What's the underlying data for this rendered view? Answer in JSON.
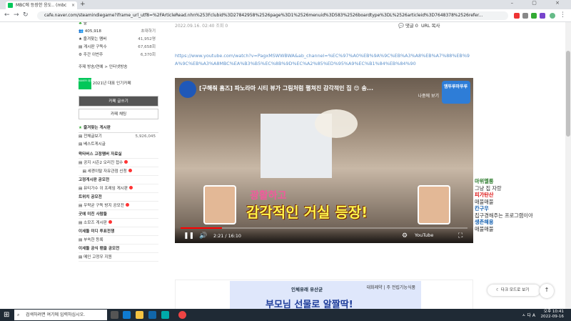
{
  "browser": {
    "tab_title": "MBC에 등장한 응도.. (mbc",
    "tab_close": "×",
    "new_tab": "+",
    "window_controls": "–  ▢  ×",
    "url": "cafe.naver.com/steamindiegame?iframe_url_utf8=%2FArticleRead.nhn%253Fclubid%3D27842958%2526page%3D1%2526menuid%3D583%2526boardtype%3DL%2526articleid%3D7648378%2526refer..."
  },
  "sidebar": {
    "rank": "숲",
    "members": "405,918",
    "members_action": "초대하기",
    "stats": [
      {
        "label": "즐겨찾는 멤버",
        "value": "41,952명"
      },
      {
        "label": "게시판 구독수",
        "value": "67,658회"
      },
      {
        "label": "주간 이번주",
        "value": "6,370회"
      }
    ],
    "theme_label": "주제 방송/연예 > 인터넷방송",
    "award": "2021년 대표 인기카페",
    "award_badge": "NAVER 대표카페",
    "write_button": "카페 글쓰기",
    "chat_button": "카페 채팅",
    "fav_board_title": "즐겨찾는 게시판",
    "fav_boards": [
      {
        "label": "전체글보기",
        "value": "5,926,045"
      },
      {
        "label": "베스트게시글",
        "value": ""
      }
    ],
    "menu": [
      "왁타버스 고정멤버 자료실",
      "공지 시즌2 오리진 접수",
      "세경이탈 자유관점 신청",
      "고정게시판 공모전",
      "뮤티가수 이 프레임 게시판",
      "트위치 공모전",
      "우왁굳 구독 방지 공모전",
      "굿에 미친 사람들",
      "소모즈 게시판",
      "이세돌 미디 투표전쟁",
      "부속한 등록",
      "이세돌 공식 팬클 공모전",
      "메인 고정우 지원"
    ]
  },
  "article": {
    "meta": "2022.09.16. 02:40  조회 0",
    "reply_label": "댓글 0",
    "url_copy": "URL 복사",
    "link": "https://www.youtube.com/watch?v=PagxMSWWBWA&ab_channel=%EC%97%A0%EB%9A%9C%EB%A3%A8%EB%A7%88%EB%9A%9C%EB%A3%A8MBC%EA%B3%B5%EC%8B%9D%EC%A2%85%ED%95%A9%EC%B1%84%EB%84%90"
  },
  "video": {
    "title": "[구해줘 홈즈] 파노라마 시티 뷰가 그림처럼 펼쳐진 감각적인 집 😍 송...",
    "later": "나중에 보기",
    "corner_badge": "엠뚜루마뚜루",
    "caption_top": "광활하고",
    "caption_main": "감각적인 거실 등장!",
    "time": "2:21 / 16:10",
    "progress": 0.145,
    "logo": "YouTube"
  },
  "ad": {
    "line1": "인체유래 유산균",
    "line2": "부모님 선물로 알짤딱!",
    "brand": "대화제약 | 주 전립기능식품"
  },
  "chat": [
    {
      "name": "마위멜롱",
      "msg": "그냥 집 자랑",
      "color": "#2a7a2a"
    },
    {
      "name": "피가탄산",
      "msg": "매불매불",
      "color": "#d11"
    },
    {
      "name": "칸구우",
      "msg": "집구경해주는 프로그램이야",
      "color": "#1460b0"
    },
    {
      "name": "생존해용",
      "msg": "매불매불",
      "color": "#1460b0"
    }
  ],
  "floating": {
    "dark_mode": "다크 모드로 보기",
    "to_top": "↑"
  },
  "taskbar": {
    "search_placeholder": "검색하려면 여기에 입력하십시오.",
    "ime": "ㅅ 다 A",
    "time": "오후 10:41",
    "date": "2022-09-16"
  }
}
